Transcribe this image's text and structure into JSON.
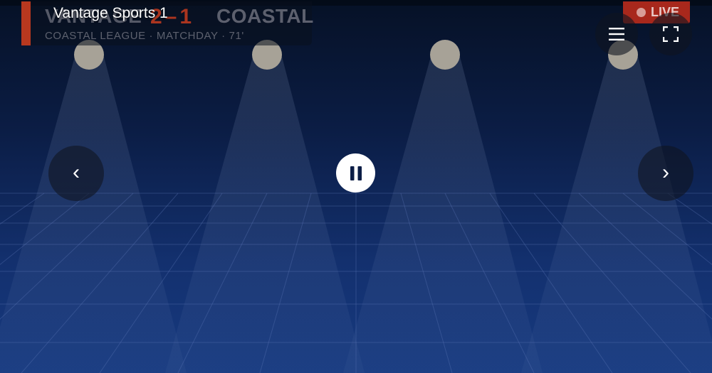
{
  "player": {
    "channel_title": "Vantage Sports 1",
    "live_label": "LIVE"
  },
  "scoreboard": {
    "home_team": "VANTAGE",
    "score": "2–1",
    "away_team": "COASTAL",
    "meta": "COASTAL LEAGUE · MATCHDAY · 71'"
  },
  "controls": {
    "menu_icon": "hamburger-menu-icon",
    "fullscreen_icon": "fullscreen-icon",
    "prev_icon": "chevron-left-icon",
    "prev_glyph": "‹",
    "next_icon": "chevron-right-icon",
    "next_glyph": "›",
    "pause_icon": "pause-icon"
  },
  "colors": {
    "live_badge": "#a8281c",
    "score_accent": "#b8381f",
    "stage_top": "#061126",
    "stage_bottom": "#173a80"
  }
}
